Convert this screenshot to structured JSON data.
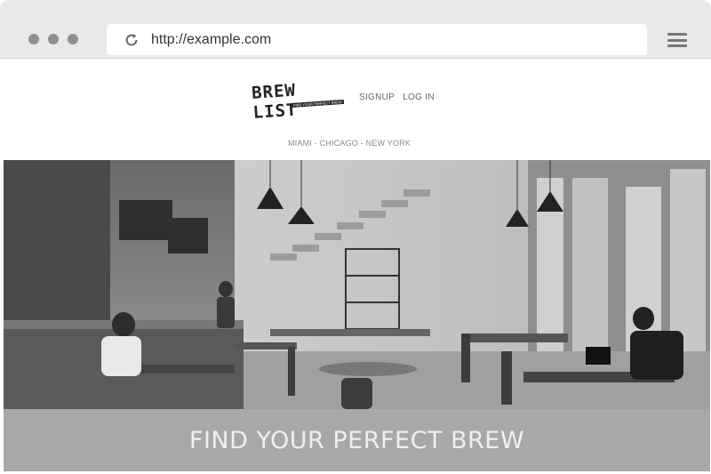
{
  "browser": {
    "url": "http://example.com"
  },
  "site": {
    "logo_text": "BREW LIST",
    "logo_tagline": "FIND YOUR PERFECT BREW",
    "nav": [
      {
        "label": "SIGNUP"
      },
      {
        "label": "LOG IN"
      }
    ],
    "cities": "MIAMI - CHICAGO - NEW YORK",
    "hero": {
      "title": "FIND YOUR PERFECT BREW"
    }
  }
}
